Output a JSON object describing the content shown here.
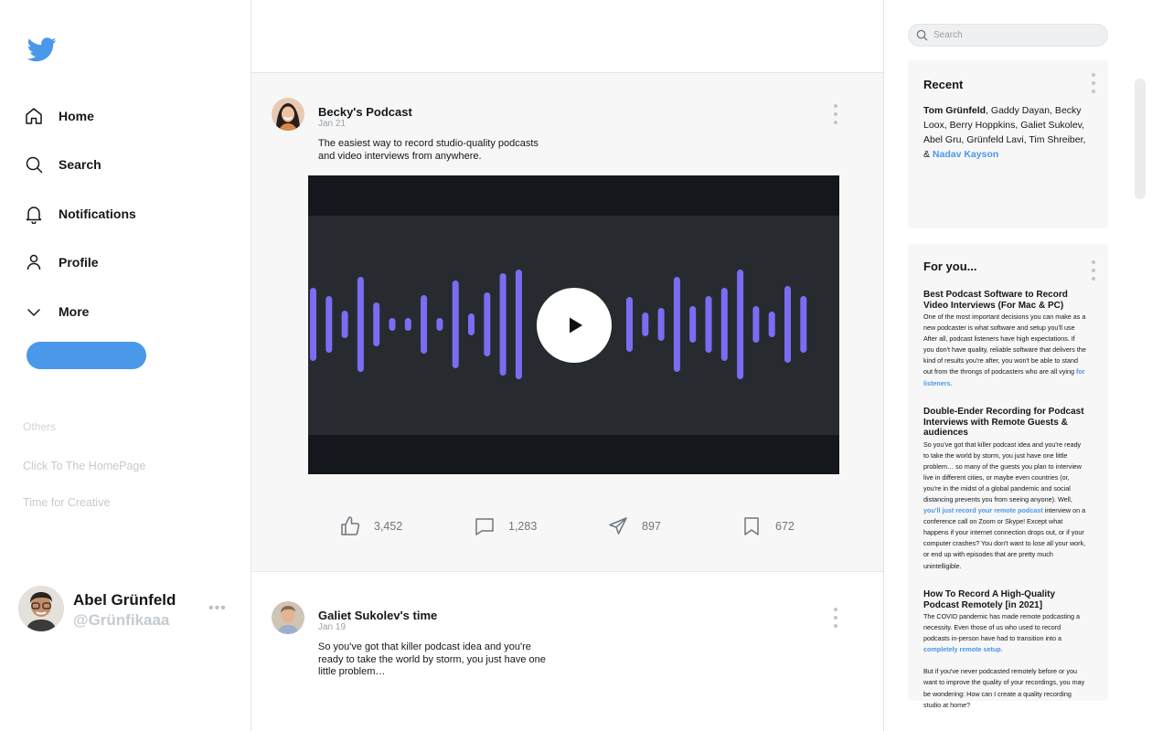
{
  "brand": {
    "icon": "twitter-bird-icon",
    "color": "#4a98e9"
  },
  "nav": {
    "items": [
      {
        "label": "Home",
        "icon": "home-icon"
      },
      {
        "label": "Search",
        "icon": "search-icon"
      },
      {
        "label": "Notifications",
        "icon": "bell-icon"
      },
      {
        "label": "Profile",
        "icon": "user-icon"
      },
      {
        "label": "More",
        "icon": "chevron-down-icon"
      }
    ],
    "post_button_label": ""
  },
  "others": {
    "title": "Others",
    "links": [
      "Click To The HomePage",
      "Time for Creative"
    ]
  },
  "user": {
    "name": "Abel Grünfeld",
    "handle": "@Grünfikaaa",
    "more": "•••"
  },
  "feed": {
    "posts": [
      {
        "author": "Becky's Podcast",
        "date": "Jan 21",
        "text": "The easiest way to record studio-quality podcasts and video interviews from anywhere.",
        "media": {
          "type": "video",
          "accent": "#7c6cf2"
        },
        "actions": [
          {
            "icon": "thumbs-up-icon",
            "count": "3,452"
          },
          {
            "icon": "comment-icon",
            "count": "1,283"
          },
          {
            "icon": "send-icon",
            "count": "897"
          },
          {
            "icon": "bookmark-icon",
            "count": "672"
          }
        ]
      },
      {
        "author": "Galiet Sukolev's time",
        "date": "Jan 19",
        "text": "So you've got that killer podcast idea and you're ready to take the world by storm, you just have one little problem…"
      }
    ]
  },
  "right": {
    "search": {
      "placeholder": "Search",
      "value": ""
    },
    "recent": {
      "title": "Recent",
      "lead_name": "Tom Grünfeld",
      "names_text": ", Gaddy Dayan, Becky Loox, Berry Hoppkins, Galiet Sukolev, Abel Gru, Grünfeld Lavi, Tim Shreiber, & ",
      "last_name": "Nadav Kayson"
    },
    "for_you": {
      "title": "For you...",
      "articles": [
        {
          "title": "Best Podcast Software to Record Video Interviews (For Mac & PC)",
          "body": "One of the most important decisions you can make as a new podcaster is what software and setup you'll use After all, podcast listeners have high expectations. If you don't have quality, reliable software that delivers the kind of results you're after, you won't be able to stand out from the throngs of podcasters who are all vying ",
          "link": "for listeners."
        },
        {
          "title": "Double-Ender Recording for Podcast Interviews with Remote Guests & audiences",
          "body_before": "So you've got that killer podcast idea and you're ready to take the world by storm, you just have one little problem… so many of the guests you plan to interview live in different cities, or maybe even countries (or, you're in the midst of a global pandemic and social distancing prevents you from seeing anyone). Well, ",
          "link": "you'll just record your remote podcast",
          "body_after": " interview on a conference call on Zoom or Skype! Except what happens if your internet connection drops out, or if your computer crashes? You don't want to lose all your work, or end up with episodes that are pretty much unintelligible."
        },
        {
          "title": "How To Record A High-Quality Podcast Remotely [in 2021]",
          "body": "The COVID pandemic has made remote podcasting a necessity. Even those of us who used to record podcasts in-person have had to transition into a ",
          "link": "completely remote setup.",
          "body2": "But if you've never podcasted remotely before or you want to improve the quality of your recordings, you may be wondering: How can I create a quality recording studio at home?"
        }
      ]
    }
  }
}
